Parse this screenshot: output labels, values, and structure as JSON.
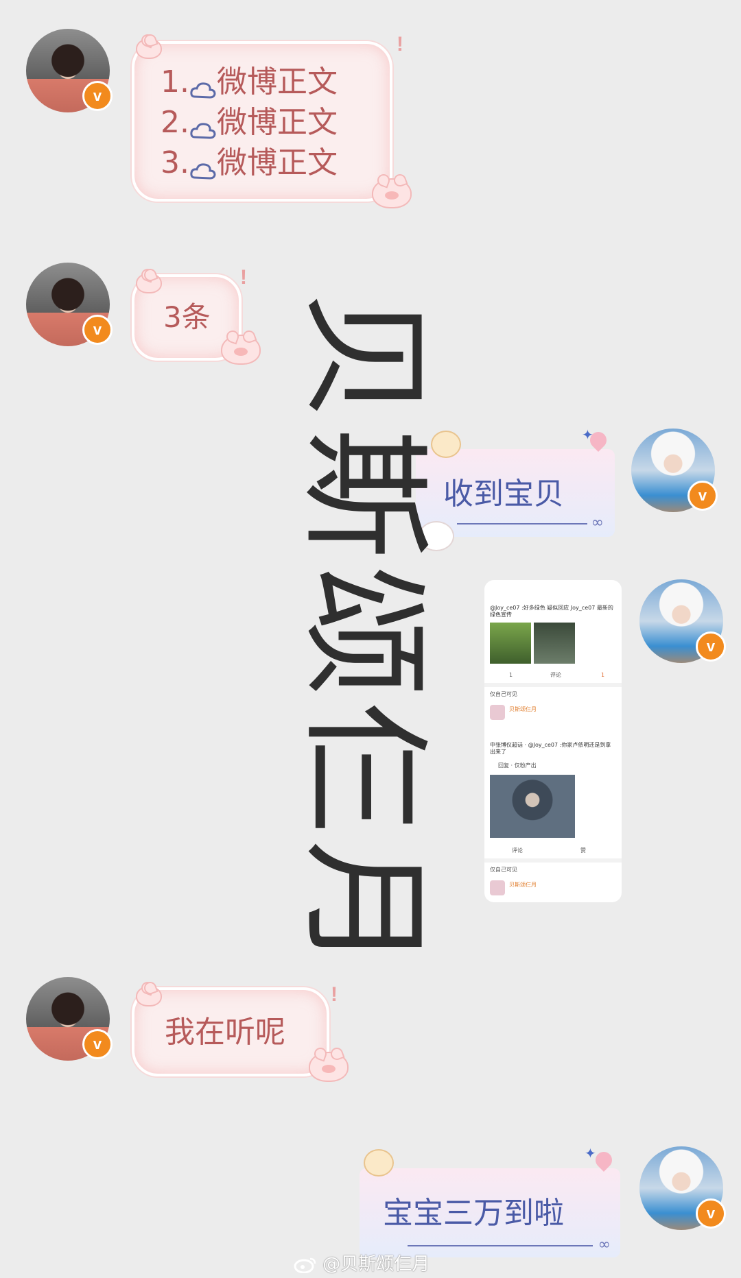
{
  "messages": {
    "m1": {
      "lines": [
        "1.",
        "微博正文",
        "2.",
        "微博正文",
        "3.",
        "微博正文"
      ]
    },
    "m2": {
      "text": "3条"
    },
    "m3": {
      "text": "收到宝贝"
    },
    "m4": {
      "text": "我在听呢"
    },
    "m5": {
      "text": "宝宝三万到啦"
    }
  },
  "watermark": {
    "text": "贝斯颂仨月"
  },
  "embedded_screenshot": {
    "post1_text": "@Joy_ce07 :好多绿色 疑似回应 Joy_ce07 最新的绿色宣传",
    "post1_count_left": "1",
    "post1_comment": "评论",
    "post1_like": "1",
    "visibility": "仅自己可见",
    "username": "贝斯颂仨月",
    "post2_text": "中张博仪超话 · @Joy_ce07 :你家卢依明还是到拿出来了",
    "post2_tag": "回复 · 仅粉产出",
    "post2_comment": "评论",
    "post2_like": "赞"
  },
  "footer": {
    "text": "@贝斯颂仨月"
  },
  "colors": {
    "pink_text": "#b65a5a",
    "blue_text": "#4a5aa6",
    "badge": "#f28a1d",
    "cloud": "#5b6aa8"
  }
}
